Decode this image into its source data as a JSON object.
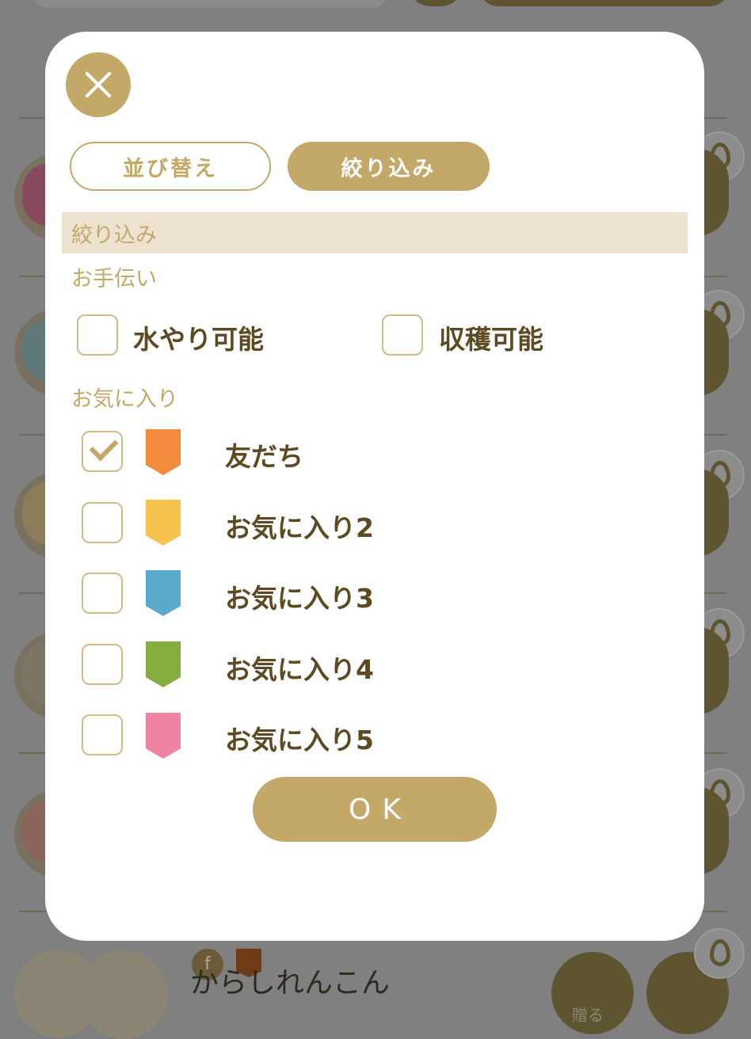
{
  "background": {
    "friend_name": "からしれんこん",
    "friend_badge": "f",
    "send_label": "贈る"
  },
  "modal": {
    "tabs": [
      {
        "label": "並び替え",
        "active": false
      },
      {
        "label": "絞り込み",
        "active": true
      }
    ],
    "section_title": "絞り込み",
    "help": {
      "label": "お手伝い",
      "options": [
        {
          "label": "水やり可能",
          "checked": false
        },
        {
          "label": "収穫可能",
          "checked": false
        }
      ]
    },
    "favorites": {
      "label": "お気に入り",
      "items": [
        {
          "label": "友だち",
          "checked": true,
          "color": "#F28B3C"
        },
        {
          "label": "お気に入り2",
          "checked": false,
          "color": "#F6C44E"
        },
        {
          "label": "お気に入り3",
          "checked": false,
          "color": "#5BA9CB"
        },
        {
          "label": "お気に入り4",
          "checked": false,
          "color": "#86AE3F"
        },
        {
          "label": "お気に入り5",
          "checked": false,
          "color": "#EE84A2"
        }
      ]
    },
    "ok_label": "OK"
  }
}
